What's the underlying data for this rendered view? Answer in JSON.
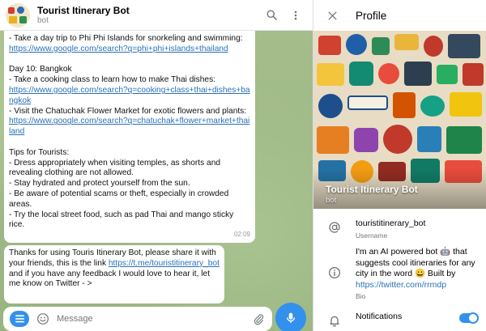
{
  "chat": {
    "title": "Tourist Itinerary Bot",
    "subtitle": "bot",
    "message1": {
      "lines": [
        {
          "text": "- Take a day trip to Phi Phi Islands for snorkeling and swimming:"
        },
        {
          "link": "https://www.google.com/search?q=phi+phi+islands+thailand"
        },
        {
          "text": " "
        },
        {
          "text": "Day 10: Bangkok"
        },
        {
          "text": "- Take a cooking class to learn how to make Thai dishes:"
        },
        {
          "link": "https://www.google.com/search?q=cooking+class+thai+dishes+bangkok"
        },
        {
          "text": "- Visit the Chatuchak Flower Market for exotic flowers and plants:"
        },
        {
          "link": "https://www.google.com/search?q=chatuchak+flower+market+thailand"
        },
        {
          "text": " "
        },
        {
          "text": "Tips for Tourists:"
        },
        {
          "text": "- Dress appropriately when visiting temples, as shorts and revealing clothing are not allowed."
        },
        {
          "text": "- Stay hydrated and protect yourself from the sun."
        },
        {
          "text": "- Be aware of potential scams or theft, especially in crowded areas."
        },
        {
          "text": "- Try the local street food, such as pad Thai and mango sticky rice."
        }
      ],
      "time": "02:09"
    },
    "message2": {
      "before": "Thanks for using Touris Itinerary Bot, please share it with your friends, this is the link ",
      "link": "https://t.me/touristitinerary_bot",
      "after": " and if you have any feedback I would love to hear it, let me know on Twitter - >"
    },
    "composer": {
      "placeholder": "Message"
    }
  },
  "profile": {
    "title": "Profile",
    "cover_name": "Tourist Itinerary Bot",
    "cover_sub": "bot",
    "username": "touristitinerary_bot",
    "username_label": "Username",
    "bio_before": "I'm an AI powered bot 🤖 that suggests cool itineraries for any city in the word 😀  Built by ",
    "bio_link": "https://twitter.com/rrmdp",
    "bio_label": "Bio",
    "notifications_label": "Notifications",
    "notifications_on": true
  },
  "colors": {
    "accent": "#3390ec",
    "link": "#2a72b5",
    "chat_background": "#9fb98b"
  },
  "icons": [
    "search-icon",
    "more-vertical-icon",
    "close-icon",
    "menu-icon",
    "emoji-icon",
    "paperclip-icon",
    "microphone-icon",
    "at-sign-icon",
    "info-icon",
    "bell-icon"
  ]
}
